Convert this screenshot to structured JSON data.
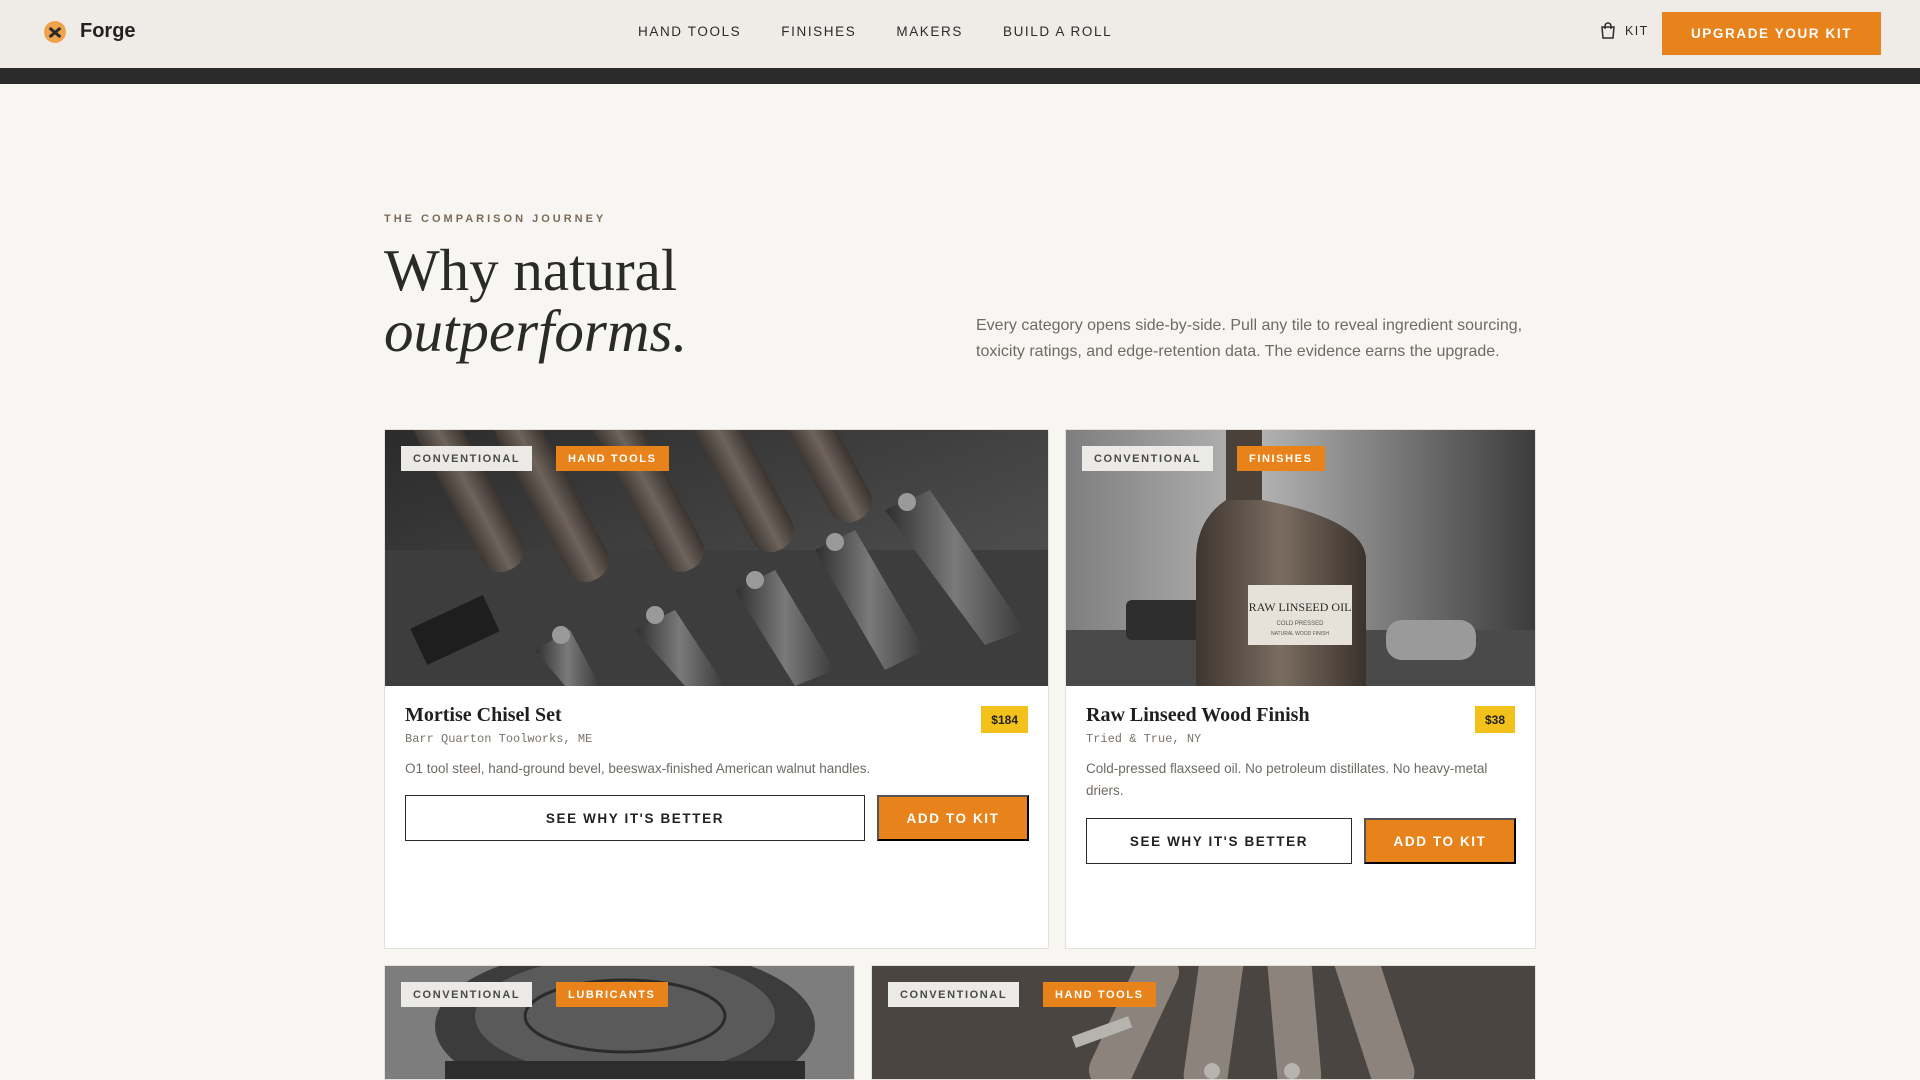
{
  "header": {
    "brand": "Forge",
    "nav": [
      "HAND TOOLS",
      "FINISHES",
      "MAKERS",
      "BUILD A ROLL"
    ],
    "kit_label": "KIT",
    "cta_label": "UPGRADE YOUR KIT"
  },
  "intro": {
    "eyebrow": "THE COMPARISON JOURNEY",
    "title_line1": "Why natural",
    "title_line2": "outperforms.",
    "copy": "Every category opens side-by-side. Pull any tile to reveal ingredient sourcing, toxicity ratings, and edge-retention data. The evidence earns the upgrade."
  },
  "cards": [
    {
      "tag_conventional": "CONVENTIONAL",
      "tag_category": "HAND TOOLS",
      "title": "Mortise Chisel Set",
      "maker": "Barr Quarton Toolworks, ME",
      "price": "$184",
      "description": "O1 tool steel, hand-ground bevel, beeswax-finished American walnut handles.",
      "secondary_label": "SEE WHY IT'S BETTER",
      "primary_label": "ADD TO KIT"
    },
    {
      "tag_conventional": "CONVENTIONAL",
      "tag_category": "FINISHES",
      "title": "Raw Linseed Wood Finish",
      "maker": "Tried & True, NY",
      "price": "$38",
      "description": "Cold-pressed flaxseed oil. No petroleum distillates. No heavy-metal driers.",
      "secondary_label": "SEE WHY IT'S BETTER",
      "primary_label": "ADD TO KIT",
      "bottle_label": "RAW LINSEED OIL",
      "bottle_sub1": "COLD PRESSED",
      "bottle_sub2": "NATURAL WOOD FINISH"
    },
    {
      "tag_conventional": "CONVENTIONAL",
      "tag_category": "LUBRICANTS"
    },
    {
      "tag_conventional": "CONVENTIONAL",
      "tag_category": "HAND TOOLS"
    }
  ],
  "colors": {
    "accent": "#e8821a",
    "price_badge": "#f2c21a",
    "background": "#f8f6f2",
    "header_bg": "#efece7"
  },
  "icons": [
    "forge-logo-icon",
    "shopping-bag-icon"
  ]
}
